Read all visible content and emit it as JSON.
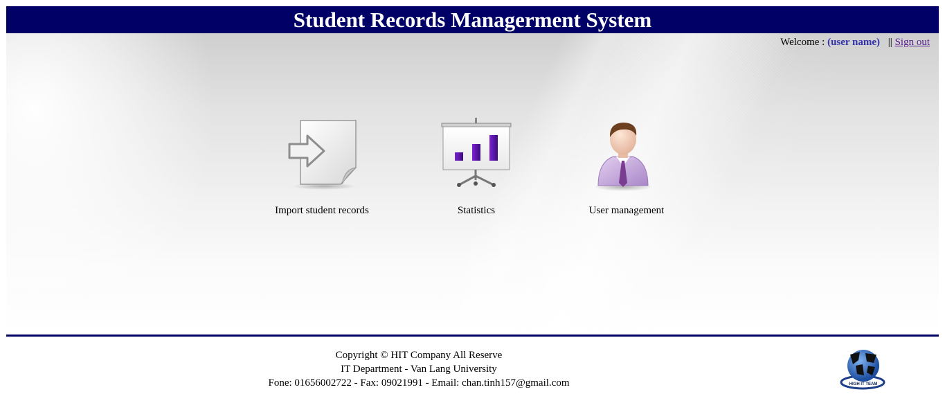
{
  "header": {
    "title": "Student Records Managerment System"
  },
  "user_bar": {
    "welcome_label": "Welcome :",
    "user_name": "(user name)",
    "separator": "||",
    "sign_out": "Sign out"
  },
  "menu": [
    {
      "label": "Import student records",
      "icon": "import-document-icon"
    },
    {
      "label": "Statistics",
      "icon": "statistics-chart-icon"
    },
    {
      "label": "User management",
      "icon": "user-icon"
    }
  ],
  "footer": {
    "line1": "Copyright © HIT Company All Reserve",
    "line2": "IT Department - Van Lang University",
    "line3": "Fone: 01656002722 - Fax: 09021991 - Email: chan.tinh157@gmail.com"
  },
  "logo": {
    "icon": "hit-team-logo",
    "text": "HIGH IT TEAM"
  },
  "colors": {
    "header_bg": "#000066",
    "header_text": "#ffffff",
    "username": "#3333aa",
    "link": "#551a8b",
    "chart_bars": "#5b0fa8"
  }
}
